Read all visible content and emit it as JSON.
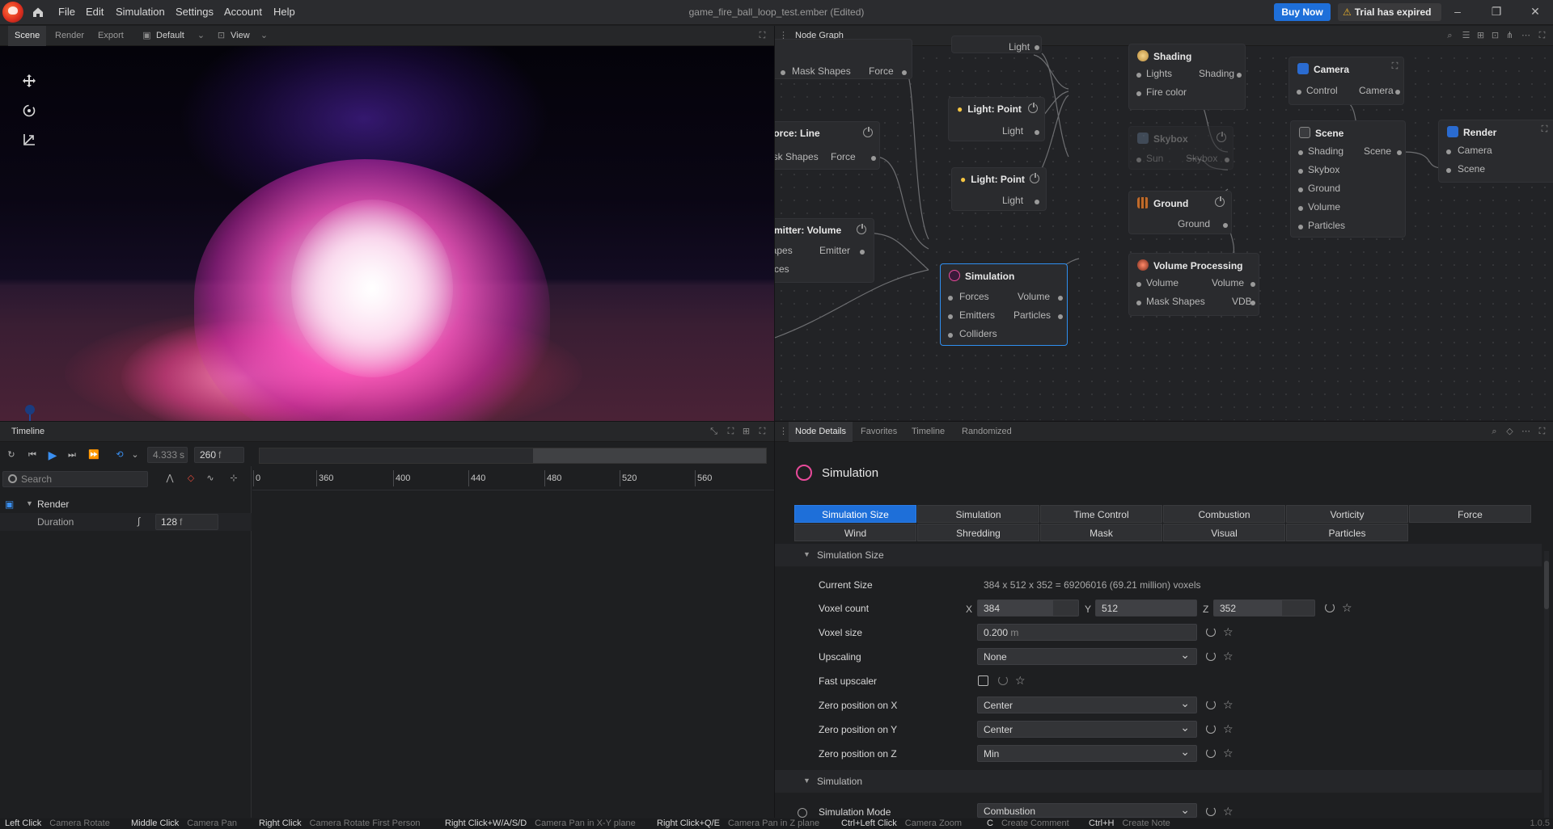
{
  "menubar": {
    "items": [
      "File",
      "Edit",
      "Simulation",
      "Settings",
      "Account",
      "Help"
    ],
    "title": "game_fire_ball_loop_test.ember (Edited)",
    "buy_label": "Buy Now",
    "trial_label": "Trial has expired",
    "win_min": "–",
    "win_restore": "❐",
    "win_close": "✕"
  },
  "viewport_panel": {
    "tabs": [
      "Scene",
      "Render",
      "Export"
    ],
    "layout_label": "Default",
    "view_label": "View"
  },
  "timeline": {
    "title": "Timeline",
    "time_seconds": "4.333",
    "time_unit": "s",
    "frame": "260",
    "frame_unit": "f",
    "search_placeholder": "Search",
    "ruler_ticks": [
      "0",
      "360",
      "400",
      "440",
      "480",
      "520",
      "560"
    ],
    "tree_root": "Render",
    "duration_label": "Duration",
    "duration_value": "128",
    "duration_unit": "f"
  },
  "nodegraph": {
    "title": "Node Graph",
    "nodes": {
      "force_top": {
        "ports": [
          "Mask Shapes",
          "Force"
        ]
      },
      "light_top": {
        "port": "Light"
      },
      "shading": {
        "title": "Shading",
        "ports": [
          "Lights",
          "Shading",
          "Fire color"
        ]
      },
      "camera": {
        "title": "Camera",
        "ports": [
          "Control",
          "Camera"
        ]
      },
      "render": {
        "title": "Render",
        "ports": [
          "Camera",
          "Scene"
        ]
      },
      "light1": {
        "title": "Light: Point",
        "port": "Light"
      },
      "force_line": {
        "title": "Force: Line",
        "ports": [
          "Mask Shapes",
          "Force"
        ]
      },
      "skybox": {
        "title": "Skybox",
        "ports": [
          "Sun",
          "Skybox"
        ]
      },
      "scene": {
        "title": "Scene",
        "ports": [
          "Shading",
          "Scene",
          "Skybox",
          "Ground",
          "Volume",
          "Particles"
        ]
      },
      "light2": {
        "title": "Light: Point",
        "port": "Light"
      },
      "ground": {
        "title": "Ground",
        "port": "Ground"
      },
      "emitter": {
        "title": "Emitter: Volume",
        "ports": [
          "Shapes",
          "Emitter",
          "Forces"
        ]
      },
      "volproc": {
        "title": "Volume Processing",
        "ports": [
          "Volume",
          "Volume",
          "Mask Shapes",
          "VDB"
        ]
      },
      "simulation": {
        "title": "Simulation",
        "ports": [
          "Forces",
          "Volume",
          "Emitters",
          "Particles",
          "Colliders"
        ]
      }
    }
  },
  "details": {
    "tabs": [
      "Node Details",
      "Favorites",
      "Timeline",
      "Randomized"
    ],
    "title": "Simulation",
    "categories_row1": [
      "Simulation Size",
      "Simulation",
      "Time Control",
      "Combustion",
      "Vorticity",
      "Force"
    ],
    "categories_row2": [
      "Wind",
      "Shredding",
      "Mask",
      "Visual",
      "Particles"
    ],
    "section1": "Simulation Size",
    "current_size_label": "Current Size",
    "current_size_value": "384 x 512 x 352 = 69206016 (69.21 million) voxels",
    "voxel_count_label": "Voxel count",
    "axis_x": "X",
    "axis_y": "Y",
    "axis_z": "Z",
    "voxel_x": "384",
    "voxel_y": "512",
    "voxel_z": "352",
    "voxel_x_level": 0.75,
    "voxel_y_level": 1.0,
    "voxel_z_level": 0.68,
    "voxel_size_label": "Voxel size",
    "voxel_size_value": "0.200",
    "voxel_size_unit": "m",
    "upscaling_label": "Upscaling",
    "upscaling_value": "None",
    "fast_upscaler_label": "Fast upscaler",
    "zero_x_label": "Zero position on X",
    "zero_x_value": "Center",
    "zero_y_label": "Zero position on Y",
    "zero_y_value": "Center",
    "zero_z_label": "Zero position on Z",
    "zero_z_value": "Min",
    "section2": "Simulation",
    "sim_mode_label": "Simulation Mode",
    "sim_mode_value": "Combustion"
  },
  "statusbar": {
    "pairs": [
      {
        "key": "Left Click",
        "action": "Camera Rotate"
      },
      {
        "key": "Middle Click",
        "action": "Camera Pan"
      },
      {
        "key": "Right Click",
        "action": "Camera Rotate First Person"
      },
      {
        "key": "Right Click+W/A/S/D",
        "action": "Camera Pan in X-Y plane"
      },
      {
        "key": "Right Click+Q/E",
        "action": "Camera Pan in Z plane"
      },
      {
        "key": "Ctrl+Left Click",
        "action": "Camera Zoom"
      },
      {
        "key": "C",
        "action": "Create Comment"
      },
      {
        "key": "Ctrl+H",
        "action": "Create Note"
      }
    ],
    "version": "1.0.5"
  },
  "colors": {
    "accent": "#1e6fd9",
    "selected_node": "#2f8ff0",
    "warning": "#f0b429"
  },
  "icons": [
    "home-icon",
    "move-icon",
    "rotate-icon",
    "scale-icon",
    "warning-icon",
    "search-icon",
    "power-icon",
    "reset-icon",
    "star-icon"
  ]
}
